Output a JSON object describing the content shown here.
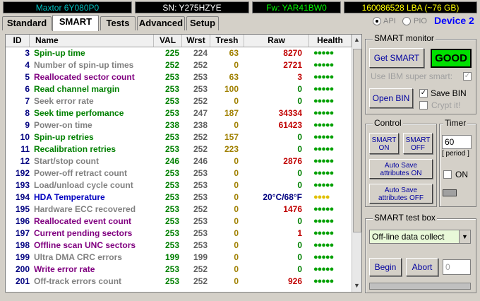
{
  "header": {
    "model": "Maxtor 6Y080P0",
    "serial": "SN: Y275HZYE",
    "firmware": "Fw: YAR41BW0",
    "lba": "160086528 LBA (~76 GB)"
  },
  "tabs": [
    {
      "label": "Standard"
    },
    {
      "label": "SMART"
    },
    {
      "label": "Tests"
    },
    {
      "label": "Advanced"
    },
    {
      "label": "Setup"
    }
  ],
  "mode": {
    "api_label": "API",
    "pio_label": "PIO",
    "device_label": "Device 2"
  },
  "table": {
    "columns": [
      "ID",
      "Name",
      "VAL",
      "Wrst",
      "Tresh",
      "Raw",
      "Health"
    ],
    "rows": [
      {
        "id": "3",
        "name": "Spin-up time",
        "val": "225",
        "wrst": "224",
        "tresh": "63",
        "raw": "8270",
        "health": "●●●●●",
        "color": "#008000"
      },
      {
        "id": "4",
        "name": "Number of spin-up times",
        "val": "252",
        "wrst": "252",
        "tresh": "0",
        "raw": "2721",
        "health": "●●●●●",
        "color": "#808080"
      },
      {
        "id": "5",
        "name": "Reallocated sector count",
        "val": "253",
        "wrst": "253",
        "tresh": "63",
        "raw": "3",
        "health": "●●●●●",
        "color": "#800080"
      },
      {
        "id": "6",
        "name": "Read channel margin",
        "val": "253",
        "wrst": "253",
        "tresh": "100",
        "raw": "0",
        "health": "●●●●●",
        "color": "#008000"
      },
      {
        "id": "7",
        "name": "Seek error rate",
        "val": "253",
        "wrst": "252",
        "tresh": "0",
        "raw": "0",
        "health": "●●●●●",
        "color": "#808080"
      },
      {
        "id": "8",
        "name": "Seek time perfomance",
        "val": "253",
        "wrst": "247",
        "tresh": "187",
        "raw": "34334",
        "health": "●●●●●",
        "color": "#008000"
      },
      {
        "id": "9",
        "name": "Power-on time",
        "val": "238",
        "wrst": "238",
        "tresh": "0",
        "raw": "61423",
        "health": "●●●●●",
        "color": "#808080"
      },
      {
        "id": "10",
        "name": "Spin-up retries",
        "val": "253",
        "wrst": "252",
        "tresh": "157",
        "raw": "0",
        "health": "●●●●●",
        "color": "#008000"
      },
      {
        "id": "11",
        "name": "Recalibration retries",
        "val": "253",
        "wrst": "252",
        "tresh": "223",
        "raw": "0",
        "health": "●●●●●",
        "color": "#008000"
      },
      {
        "id": "12",
        "name": "Start/stop count",
        "val": "246",
        "wrst": "246",
        "tresh": "0",
        "raw": "2876",
        "health": "●●●●●",
        "color": "#808080"
      },
      {
        "id": "192",
        "name": "Power-off retract count",
        "val": "253",
        "wrst": "253",
        "tresh": "0",
        "raw": "0",
        "health": "●●●●●",
        "color": "#808080"
      },
      {
        "id": "193",
        "name": "Load/unload cycle count",
        "val": "253",
        "wrst": "253",
        "tresh": "0",
        "raw": "0",
        "health": "●●●●●",
        "color": "#808080"
      },
      {
        "id": "194",
        "name": "HDA Temperature",
        "val": "253",
        "wrst": "253",
        "tresh": "0",
        "raw": "20°C/68°F",
        "health": "●●●●",
        "color": "#0000c0"
      },
      {
        "id": "195",
        "name": "Hardware ECC recovered",
        "val": "253",
        "wrst": "252",
        "tresh": "0",
        "raw": "1476",
        "health": "●●●●●",
        "color": "#808080"
      },
      {
        "id": "196",
        "name": "Reallocated event count",
        "val": "253",
        "wrst": "253",
        "tresh": "0",
        "raw": "0",
        "health": "●●●●●",
        "color": "#800080"
      },
      {
        "id": "197",
        "name": "Current pending sectors",
        "val": "253",
        "wrst": "253",
        "tresh": "0",
        "raw": "1",
        "health": "●●●●●",
        "color": "#800080"
      },
      {
        "id": "198",
        "name": "Offline scan UNC sectors",
        "val": "253",
        "wrst": "253",
        "tresh": "0",
        "raw": "0",
        "health": "●●●●●",
        "color": "#800080"
      },
      {
        "id": "199",
        "name": "Ultra DMA CRC errors",
        "val": "199",
        "wrst": "199",
        "tresh": "0",
        "raw": "0",
        "health": "●●●●●",
        "color": "#808080"
      },
      {
        "id": "200",
        "name": "Write error rate",
        "val": "253",
        "wrst": "252",
        "tresh": "0",
        "raw": "0",
        "health": "●●●●●",
        "color": "#800080"
      },
      {
        "id": "201",
        "name": "Off-track errors count",
        "val": "253",
        "wrst": "252",
        "tresh": "0",
        "raw": "926",
        "health": "●●●●●",
        "color": "#808080"
      }
    ]
  },
  "smart_monitor": {
    "title": "SMART monitor",
    "get_smart": "Get SMART",
    "status": "GOOD",
    "ibm_label": "Use IBM super smart:",
    "open_bin": "Open BIN",
    "save_bin": "Save BIN",
    "crypt": "Crypt it!"
  },
  "control": {
    "title": "Control",
    "smart_on": "SMART ON",
    "smart_off": "SMART OFF",
    "autosave_on": "Auto Save attributes ON",
    "autosave_off": "Auto Save attributes OFF"
  },
  "timer": {
    "title": "Timer",
    "value": "60",
    "period": "[ period ]",
    "on_label": "ON"
  },
  "test_box": {
    "title": "SMART test box",
    "selected": "Off-line data collect",
    "begin": "Begin",
    "abort": "Abort",
    "count": "0"
  },
  "colors": {
    "good": "#00e000",
    "header_bg": "#000000",
    "device": "#0000ff"
  }
}
